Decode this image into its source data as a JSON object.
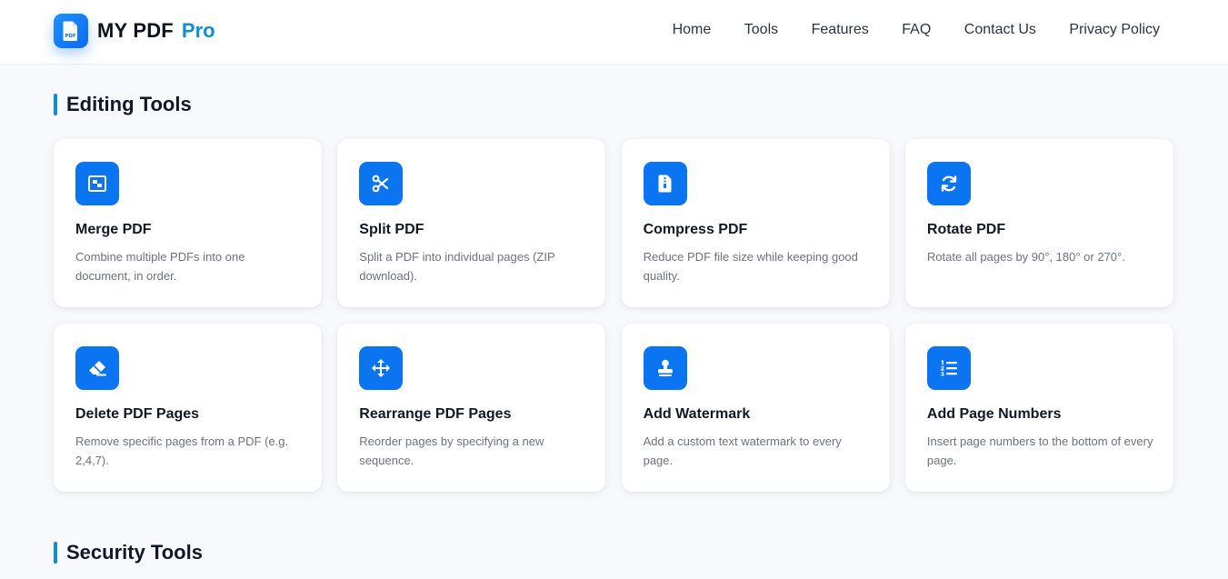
{
  "brand": {
    "name": "MY PDF",
    "accent": "Pro",
    "badge_text": "PDF",
    "accent_color": "#0d8fd6",
    "primary_color": "#0b74f0"
  },
  "nav": [
    {
      "label": "Home"
    },
    {
      "label": "Tools"
    },
    {
      "label": "Features"
    },
    {
      "label": "FAQ"
    },
    {
      "label": "Contact Us"
    },
    {
      "label": "Privacy Policy"
    }
  ],
  "sections": [
    {
      "title": "Editing Tools"
    },
    {
      "title": "Security Tools"
    }
  ],
  "tools": [
    {
      "icon": "merge-icon",
      "title": "Merge PDF",
      "desc": "Combine multiple PDFs into one document, in order."
    },
    {
      "icon": "scissors-icon",
      "title": "Split PDF",
      "desc": "Split a PDF into individual pages (ZIP download)."
    },
    {
      "icon": "compress-file-icon",
      "title": "Compress PDF",
      "desc": "Reduce PDF file size while keeping good quality."
    },
    {
      "icon": "rotate-icon",
      "title": "Rotate PDF",
      "desc": "Rotate all pages by 90°, 180° or 270°."
    },
    {
      "icon": "eraser-icon",
      "title": "Delete PDF Pages",
      "desc": "Remove specific pages from a PDF (e.g. 2,4,7)."
    },
    {
      "icon": "move-arrows-icon",
      "title": "Rearrange PDF Pages",
      "desc": "Reorder pages by specifying a new sequence."
    },
    {
      "icon": "stamp-icon",
      "title": "Add Watermark",
      "desc": "Add a custom text watermark to every page."
    },
    {
      "icon": "numbered-list-icon",
      "title": "Add Page Numbers",
      "desc": "Insert page numbers to the bottom of every page."
    }
  ]
}
